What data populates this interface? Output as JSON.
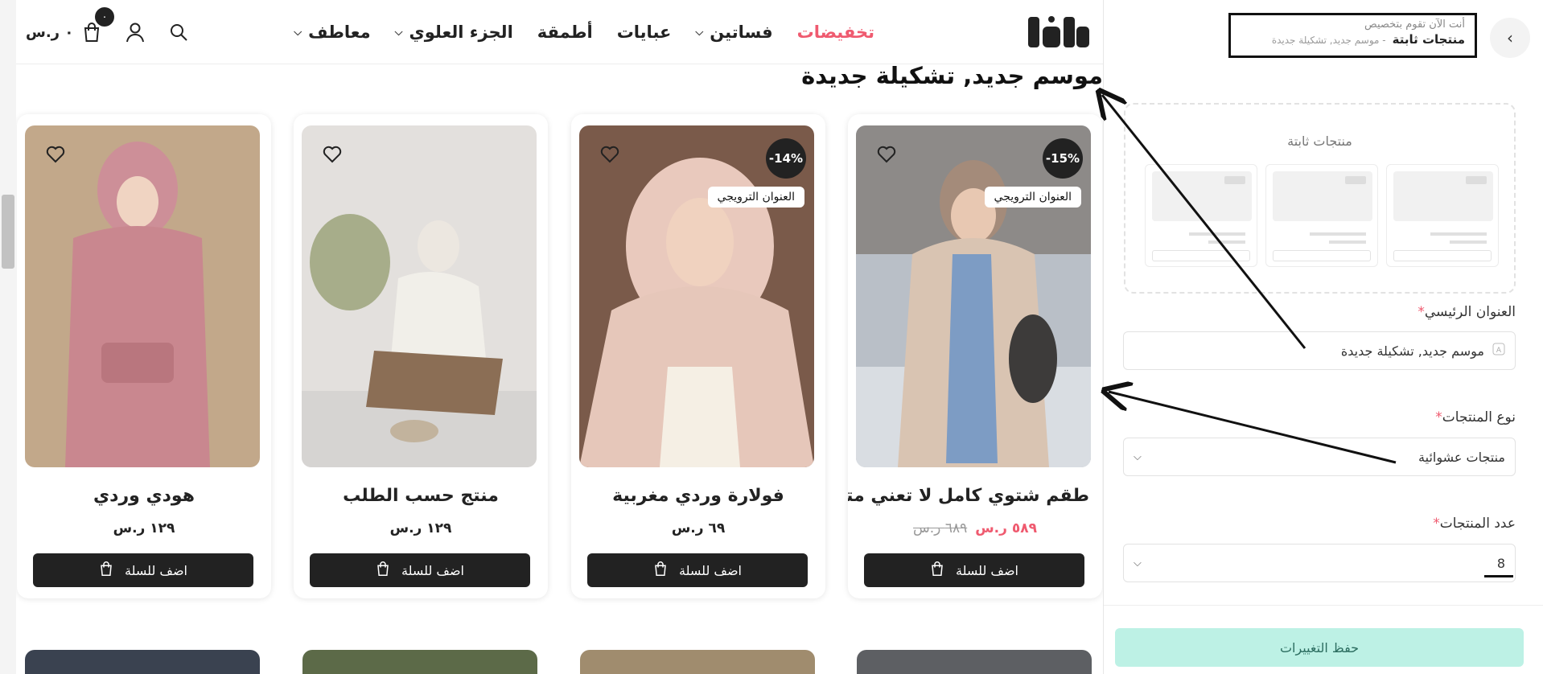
{
  "store": {
    "cart_total": "٠ ر.س",
    "cart_count": "٠",
    "nav": [
      {
        "label": "تخفيضات",
        "dropdown": false
      },
      {
        "label": "فساتين",
        "dropdown": true
      },
      {
        "label": "عبايات",
        "dropdown": false
      },
      {
        "label": "أطمقة",
        "dropdown": false
      },
      {
        "label": "الجزء العلوي",
        "dropdown": true
      },
      {
        "label": "معاطف",
        "dropdown": true
      }
    ],
    "section_title": "موسم جديد, تشكيلة جديدة",
    "add_to_cart_label": "اضف للسلة",
    "products": [
      {
        "name": "طقم شتوي كامل لا تعني متاب...",
        "price": "٥٨٩ ر.س",
        "old_price": "٦٨٩ ر.س",
        "discount": "-15%",
        "promo": "العنوان الترويجي"
      },
      {
        "name": "فولارة وردي مغربية",
        "price": "٦٩ ر.س",
        "discount": "-14%",
        "promo": "العنوان الترويجي"
      },
      {
        "name": "منتج حسب الطلب",
        "price": "١٢٩ ر.س"
      },
      {
        "name": "هودي وردي",
        "price": "١٢٩ ر.س"
      }
    ]
  },
  "panel": {
    "hint": "أنت الآن تقوم بتخصيص",
    "crumb_main": "منتجات ثابتة",
    "crumb_sub": "- موسم جديد, تشكيلة جديدة",
    "placeholder_title": "منتجات ثابتة",
    "title_label": "العنوان الرئيسي",
    "title_value": "موسم جديد, تشكيلة جديدة",
    "type_label": "نوع المنتجات",
    "type_value": "منتجات عشوائية",
    "count_label": "عدد المنتجات",
    "count_value": "8",
    "save_label": "حفظ التغييرات"
  },
  "colors": {
    "accent_sale": "#ef5a6f",
    "save_button_bg": "#bdf1e5",
    "dark": "#222222"
  }
}
